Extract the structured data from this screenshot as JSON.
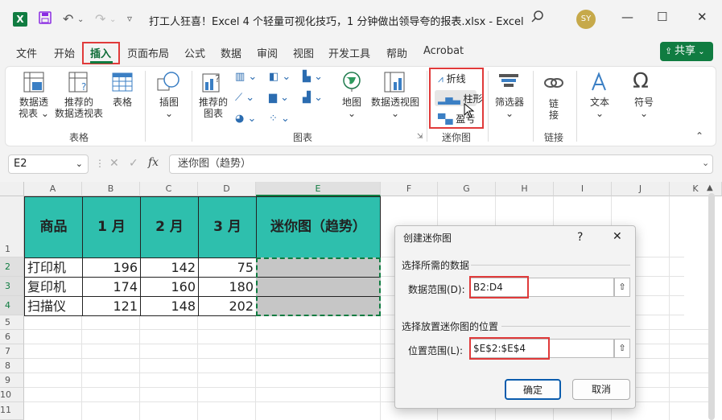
{
  "window": {
    "title": "打工人狂喜！Excel 4 个轻量可视化技巧，1 分钟做出领导夸的报表.xlsx  -  Excel",
    "avatar": "SY",
    "app_logo": "X"
  },
  "menu": {
    "tabs": [
      "文件",
      "开始",
      "插入",
      "页面布局",
      "公式",
      "数据",
      "审阅",
      "视图",
      "开发工具",
      "帮助",
      "Acrobat"
    ],
    "active": "插入",
    "share": "共享"
  },
  "ribbon": {
    "pivot": "数据透\n视表",
    "pivot_l1": "数据透",
    "pivot_l2": "视表",
    "rec_pivot_l1": "推荐的",
    "rec_pivot_l2": "数据透视表",
    "table": "表格",
    "group_table": "表格",
    "illus": "插图",
    "rec_chart_l1": "推荐的",
    "rec_chart_l2": "图表",
    "map": "地图",
    "pivot_chart": "数据透视图",
    "group_chart": "图表",
    "spark_line": "折线",
    "spark_column": "柱形",
    "spark_winloss": "盈亏",
    "group_spark": "迷你图",
    "filter": "筛选器",
    "link_l1": "链",
    "link_l2": "接",
    "group_link": "链接",
    "text": "文本",
    "symbol": "符号"
  },
  "formula_bar": {
    "namebox": "E2",
    "fx": "fx",
    "content": "迷你图（趋势）"
  },
  "columns": [
    "A",
    "B",
    "C",
    "D",
    "E",
    "F",
    "G",
    "H",
    "I",
    "J",
    "K"
  ],
  "rows": [
    "1",
    "2",
    "3",
    "4",
    "5",
    "6",
    "7",
    "8",
    "9",
    "10",
    "11"
  ],
  "table": {
    "headers": [
      "商品",
      "1 月",
      "2 月",
      "3 月",
      "迷你图（趋势）"
    ],
    "rows": [
      {
        "name": "打印机",
        "m1": "196",
        "m2": "142",
        "m3": "75"
      },
      {
        "name": "复印机",
        "m1": "174",
        "m2": "160",
        "m3": "180"
      },
      {
        "name": "扫描仪",
        "m1": "121",
        "m2": "148",
        "m3": "202"
      }
    ]
  },
  "dialog": {
    "title": "创建迷你图",
    "help": "?",
    "close": "✕",
    "section1": "选择所需的数据",
    "data_range_label": "数据范围(D):",
    "data_range_value": "B2:D4",
    "section2": "选择放置迷你图的位置",
    "location_label": "位置范围(L):",
    "location_value": "$E$2:$E$4",
    "ok": "确定",
    "cancel": "取消"
  },
  "colors": {
    "header_fill": "#2ebfad",
    "excel_green": "#107c41",
    "highlight_red": "#e03a3a"
  }
}
